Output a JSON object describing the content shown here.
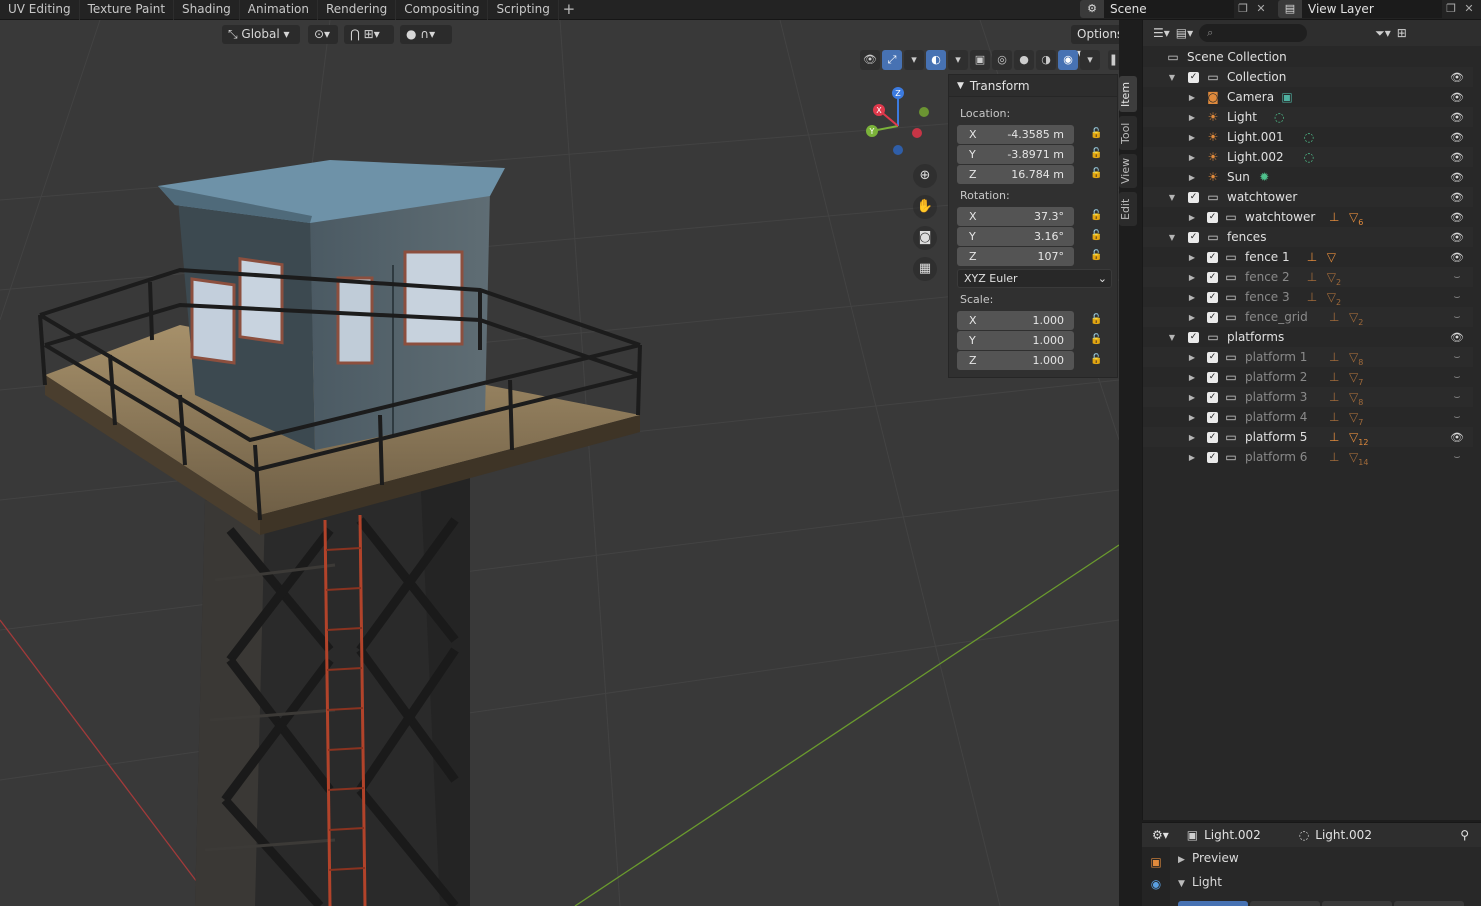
{
  "topbar": {
    "tabs": [
      "UV Editing",
      "Texture Paint",
      "Shading",
      "Animation",
      "Rendering",
      "Compositing",
      "Scripting"
    ],
    "add_tab": "+",
    "scene": "Scene",
    "view_layer": "View Layer"
  },
  "viewport": {
    "orientation": "Global",
    "options": "Options",
    "gizmo_axes": [
      "X",
      "Y",
      "Z"
    ],
    "axis_colors": {
      "x": "#e0394c",
      "y": "#7bb33a",
      "z": "#3c7be0"
    }
  },
  "npanel": {
    "title": "Transform",
    "location_label": "Location:",
    "rotation_label": "Rotation:",
    "scale_label": "Scale:",
    "location": [
      {
        "axis": "X",
        "value": "-4.3585 m"
      },
      {
        "axis": "Y",
        "value": "-3.8971 m"
      },
      {
        "axis": "Z",
        "value": "16.784 m"
      }
    ],
    "rotation": [
      {
        "axis": "X",
        "value": "37.3°"
      },
      {
        "axis": "Y",
        "value": "3.16°"
      },
      {
        "axis": "Z",
        "value": "107°"
      }
    ],
    "rotation_mode": "XYZ Euler",
    "scale": [
      {
        "axis": "X",
        "value": "1.000"
      },
      {
        "axis": "Y",
        "value": "1.000"
      },
      {
        "axis": "Z",
        "value": "1.000"
      }
    ],
    "side_tabs": [
      "Item",
      "Tool",
      "View",
      "Edit"
    ]
  },
  "outliner": {
    "scene_collection": "Scene Collection",
    "rows": [
      {
        "label": "Collection",
        "type": "collection"
      },
      {
        "label": "Camera",
        "type": "camera"
      },
      {
        "label": "Light",
        "type": "light"
      },
      {
        "label": "Light.001",
        "type": "light"
      },
      {
        "label": "Light.002",
        "type": "light"
      },
      {
        "label": "Sun",
        "type": "sun"
      },
      {
        "label": "watchtower",
        "type": "collection"
      },
      {
        "label": "watchtower",
        "type": "empty",
        "count": "6"
      },
      {
        "label": "fences",
        "type": "collection"
      },
      {
        "label": "fence 1",
        "type": "empty"
      },
      {
        "label": "fence 2",
        "type": "empty",
        "count": "2"
      },
      {
        "label": "fence 3",
        "type": "empty",
        "count": "2"
      },
      {
        "label": "fence_grid",
        "type": "empty",
        "count": "2"
      },
      {
        "label": "platforms",
        "type": "collection"
      },
      {
        "label": "platform 1",
        "type": "empty",
        "count": "8"
      },
      {
        "label": "platform 2",
        "type": "empty",
        "count": "7"
      },
      {
        "label": "platform 3",
        "type": "empty",
        "count": "8"
      },
      {
        "label": "platform 4",
        "type": "empty",
        "count": "7"
      },
      {
        "label": "platform 5",
        "type": "empty",
        "count": "12"
      },
      {
        "label": "platform 6",
        "type": "empty",
        "count": "14"
      }
    ]
  },
  "properties": {
    "object_name": "Light.002",
    "data_name": "Light.002",
    "sections": [
      "Preview",
      "Light"
    ]
  }
}
